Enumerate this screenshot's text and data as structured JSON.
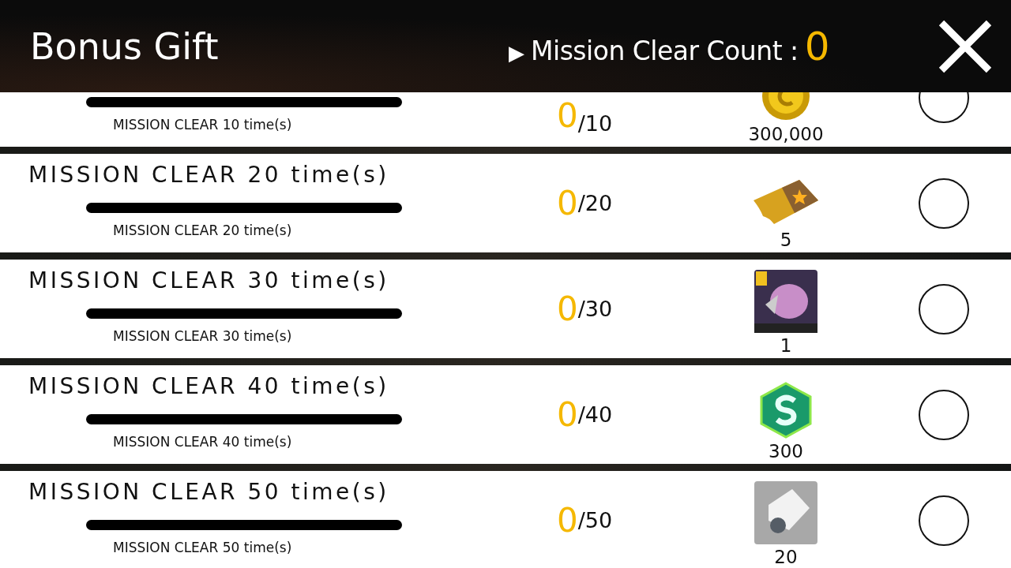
{
  "header": {
    "title": "Bonus Gift",
    "count_marker": "▶",
    "count_label": "Mission Clear Count :",
    "count_value": "0"
  },
  "missions": [
    {
      "label": "MISSION CLEAR 10 time(s)",
      "level": 0,
      "current": "0",
      "target": "/10",
      "reward": {
        "kind": "coin",
        "amount": "300,000"
      },
      "checked": false
    },
    {
      "title": "MISSION CLEAR 20 time(s)",
      "label": "MISSION CLEAR 20 time(s)",
      "level": 0,
      "current": "0",
      "target": "/20",
      "reward": {
        "kind": "ticket",
        "amount": "5"
      },
      "checked": false
    },
    {
      "title": "MISSION CLEAR 30 time(s)",
      "label": "MISSION CLEAR 30 time(s)",
      "level": 0,
      "current": "0",
      "target": "/30",
      "reward": {
        "kind": "card",
        "amount": "1"
      },
      "checked": false
    },
    {
      "title": "MISSION CLEAR 40 time(s)",
      "label": "MISSION CLEAR 40 time(s)",
      "level": 0,
      "current": "0",
      "target": "/40",
      "reward": {
        "kind": "gem",
        "amount": "300"
      },
      "checked": false
    },
    {
      "title": "MISSION CLEAR 50 time(s)",
      "label": "MISSION CLEAR 50 time(s)",
      "level": 0,
      "current": "0",
      "target": "/50",
      "reward": {
        "kind": "part",
        "amount": "20"
      },
      "checked": false
    }
  ]
}
